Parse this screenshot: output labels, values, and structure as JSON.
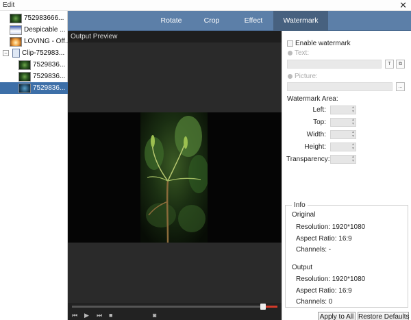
{
  "window": {
    "title": "Edit",
    "close_glyph": "✕"
  },
  "tree": {
    "items": [
      {
        "label": "752983666...",
        "thumb": "t-plant"
      },
      {
        "label": "Despicable ...",
        "thumb": "t-desp"
      },
      {
        "label": "LOVING - Off...",
        "thumb": "t-loving"
      },
      {
        "label": "Clip-752983...",
        "expander": "−"
      },
      {
        "label": "7529836...",
        "thumb": "t-plant"
      },
      {
        "label": "7529836...",
        "thumb": "t-plant"
      },
      {
        "label": "7529836...",
        "thumb": "t-sel"
      }
    ]
  },
  "tabs": [
    {
      "label": "Rotate"
    },
    {
      "label": "Crop"
    },
    {
      "label": "Effect"
    },
    {
      "label": "Watermark"
    }
  ],
  "preview": {
    "title": "Output Preview"
  },
  "watermark": {
    "enable_label": "Enable watermark",
    "text_label": "Text:",
    "text_btn1": "T",
    "text_btn2": "⧉",
    "picture_label": "Picture:",
    "picture_btn": "...",
    "area_label": "Watermark Area:",
    "left_label": "Left:",
    "top_label": "Top:",
    "width_label": "Width:",
    "height_label": "Height:",
    "transparency_label": "Transparency:"
  },
  "info": {
    "legend": "Info",
    "original": {
      "heading": "Original",
      "resolution": "Resolution: 1920*1080",
      "aspect": "Aspect Ratio: 16:9",
      "channels": "Channels: -"
    },
    "output": {
      "heading": "Output",
      "resolution": "Resolution: 1920*1080",
      "aspect": "Aspect Ratio: 16:9",
      "channels": "Channels: 0"
    }
  },
  "buttons": {
    "apply_all": "Apply to All",
    "restore": "Restore Defaults"
  },
  "player": {
    "first": "⏮",
    "play": "▶",
    "next": "⏭",
    "stop": "■",
    "snapshot": "◙"
  },
  "colors": {
    "accent_tab_bar": "#5c7fa8",
    "active_tab": "#47617f",
    "selection": "#3d6fa8",
    "progress": "#d23a2a"
  }
}
